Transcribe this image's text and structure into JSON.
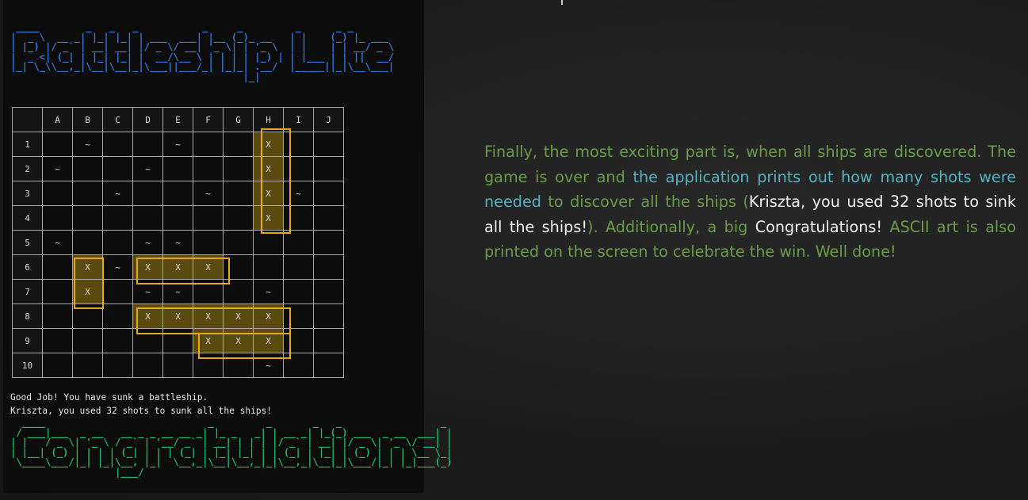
{
  "console": {
    "ascii_title": " ____        _   _   _           _     _         _      _ _\n|  _ \\  __ _| |_| |_| | ___  ___| |__ (_)_ __   | |    (_) |_ ___\n| |_) |/ _` | __| __| |/ _ \\/ __| '_ \\| | '_ \\  | |    | | __/ _ \\\n|  _ <| (_| | |_| |_| |  __/\\__ \\ | | | | |_) | | |___ | | ||  __/\n|_| \\_\\\\__,_|\\__|\\__|_|\\___||___/_| |_|_| .__/  |_____||_|\\__\\___|\n                                        |_|",
    "columns": [
      "A",
      "B",
      "C",
      "D",
      "E",
      "F",
      "G",
      "H",
      "I",
      "J"
    ],
    "rows": [
      {
        "label": "1",
        "cells": [
          "",
          "~",
          "",
          "",
          "~",
          "",
          "",
          "X",
          "",
          ""
        ]
      },
      {
        "label": "2",
        "cells": [
          "~",
          "",
          "",
          "~",
          "",
          "",
          "",
          "X",
          "",
          ""
        ]
      },
      {
        "label": "3",
        "cells": [
          "",
          "",
          "~",
          "",
          "",
          "~",
          "",
          "X",
          "~",
          ""
        ]
      },
      {
        "label": "4",
        "cells": [
          "",
          "",
          "",
          "",
          "",
          "",
          "",
          "X",
          "",
          ""
        ]
      },
      {
        "label": "5",
        "cells": [
          "~",
          "",
          "",
          "~",
          "~",
          "",
          "",
          "",
          "",
          ""
        ]
      },
      {
        "label": "6",
        "cells": [
          "",
          "X",
          "~",
          "X",
          "X",
          "X",
          "",
          "",
          "",
          ""
        ]
      },
      {
        "label": "7",
        "cells": [
          "",
          "X",
          "",
          "~",
          "~",
          "",
          "",
          "~",
          "",
          ""
        ]
      },
      {
        "label": "8",
        "cells": [
          "",
          "",
          "",
          "X",
          "X",
          "X",
          "X",
          "X",
          "",
          ""
        ]
      },
      {
        "label": "9",
        "cells": [
          "",
          "",
          "",
          "",
          "",
          "X",
          "X",
          "X",
          "",
          ""
        ]
      },
      {
        "label": "10",
        "cells": [
          "",
          "",
          "",
          "",
          "",
          "",
          "",
          "~",
          "",
          ""
        ]
      }
    ],
    "messages": [
      "Good Job! You have sunk a battleship.",
      "Kriszta, you used 32 shots to sunk all the ships!"
    ],
    "ascii_congrats": "  ____                            _         _       _   _                 _\n / ___|___  _ __   __ _ _ __ __ _| |_ _   _| | __ _| |_(_) ___  _ __  ___| |\n| |   / _ \\| '_ \\ / _` | '__/ _` | __| | | | |/ _` | __| |/ _ \\| '_ \\/ __| |\n| |__| (_) | | | | (_| | | | (_| | |_| |_| | | (_| | |_| | (_) | | | \\__ \\_|\n \\____\\___/|_| |_|\\__, |_|  \\__,_|\\__|\\__,_|_|\\__,_|\\__|_|\\___/|_| |_|___(_)\n                  |___/",
    "colors": {
      "title": "#3a78d8",
      "congrats": "#1fb96a",
      "highlight": "#e6a91d",
      "hit_fill": "#5a4a10"
    }
  },
  "description": {
    "seg1": "Finally, the most exciting part is, when all ships are discovered. The game is over and ",
    "seg2": "the application prints out how many shots were needed",
    "seg3": " to discover all the ships (",
    "seg4": "Kriszta, you used 32 shots to sink all the ships!",
    "seg5": "). Additionally, a big ",
    "seg6": "Congratulations!",
    "seg7": " ASCII art is also printed on the screen to celebrate the win. Well done!",
    "colors": {
      "green": "#6a9c4a",
      "teal": "#55b3c1",
      "white": "#f2f2f2"
    }
  }
}
